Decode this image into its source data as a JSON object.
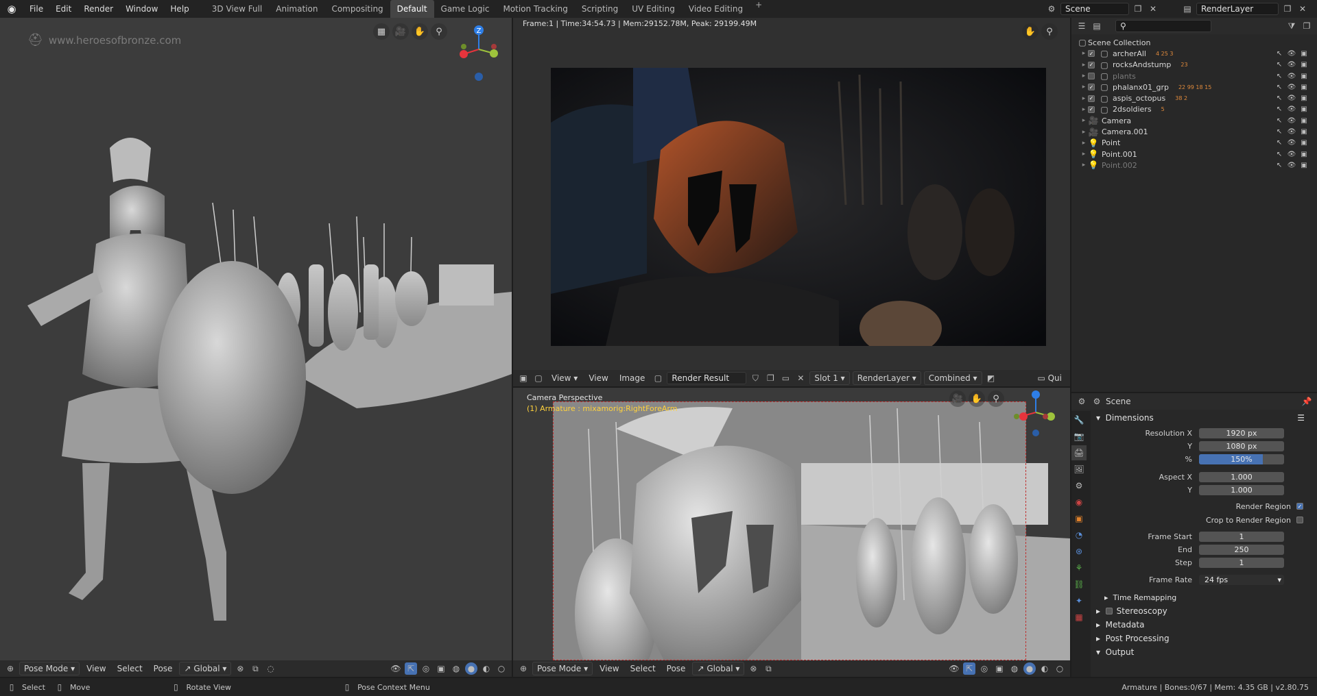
{
  "menus": [
    "File",
    "Edit",
    "Render",
    "Window",
    "Help"
  ],
  "workspaces": [
    "3D View Full",
    "Animation",
    "Compositing",
    "Default",
    "Game Logic",
    "Motion Tracking",
    "Scripting",
    "UV Editing",
    "Video Editing"
  ],
  "active_workspace": "Default",
  "scene": {
    "name": "Scene",
    "render_layer": "RenderLayer"
  },
  "left_viewport": {
    "watermark": "www.heroesofbronze.com",
    "gizmo": {
      "z": "Z",
      "x": "X",
      "y": "Y"
    },
    "header": {
      "editor_icon": "cube-icon",
      "mode": "Pose Mode",
      "view": "View",
      "select": "Select",
      "pose": "Pose",
      "orientation": "Global"
    }
  },
  "render_view": {
    "info": "Frame:1 | Time:34:54.73 | Mem:29152.78M, Peak: 29199.49M",
    "header": {
      "view1": "View",
      "view2": "View",
      "image": "Image",
      "image_name": "Render Result",
      "slot": "Slot 1",
      "layer": "RenderLayer",
      "pass": "Combined",
      "quick": "Qui"
    }
  },
  "camera_viewport": {
    "label": "Camera Perspective",
    "armature": "(1) Armature : mixamorig:RightForeArm",
    "header": {
      "mode": "Pose Mode",
      "view": "View",
      "select": "Select",
      "pose": "Pose",
      "orientation": "Global"
    }
  },
  "outliner": {
    "root": "Scene Collection",
    "items": [
      {
        "name": "archerAll",
        "checked": true,
        "type": "collection",
        "badges": "4 25 3"
      },
      {
        "name": "rocksAndstump",
        "checked": true,
        "type": "collection",
        "badges": "23"
      },
      {
        "name": "plants",
        "checked": false,
        "type": "collection",
        "badges": ""
      },
      {
        "name": "phalanx01_grp",
        "checked": true,
        "type": "collection",
        "badges": "22 99 18 15"
      },
      {
        "name": "aspis_octopus",
        "checked": true,
        "type": "collection",
        "badges": "38 2"
      },
      {
        "name": "2dsoldiers",
        "checked": true,
        "type": "collection",
        "badges": "5"
      },
      {
        "name": "Camera",
        "checked": null,
        "type": "camera",
        "badges": ""
      },
      {
        "name": "Camera.001",
        "checked": null,
        "type": "camera",
        "badges": ""
      },
      {
        "name": "Point",
        "checked": null,
        "type": "light",
        "badges": ""
      },
      {
        "name": "Point.001",
        "checked": null,
        "type": "light",
        "badges": ""
      },
      {
        "name": "Point.002",
        "checked": null,
        "type": "light",
        "badges": ""
      }
    ]
  },
  "properties": {
    "context": "Scene",
    "dimensions": "Dimensions",
    "resolution_x_label": "Resolution X",
    "resolution_x": "1920 px",
    "resolution_y_label": "Y",
    "resolution_y": "1080 px",
    "percent_label": "%",
    "percent": "150%",
    "percent_fill": 0.75,
    "aspect_x_label": "Aspect X",
    "aspect_x": "1.000",
    "aspect_y_label": "Y",
    "aspect_y": "1.000",
    "render_region": "Render Region",
    "render_region_on": true,
    "crop_region": "Crop to Render Region",
    "crop_region_on": false,
    "frame_start_label": "Frame Start",
    "frame_start": "1",
    "end_label": "End",
    "end": "250",
    "step_label": "Step",
    "step": "1",
    "frame_rate_label": "Frame Rate",
    "frame_rate": "24 fps",
    "time_remapping": "Time Remapping",
    "stereoscopy": "Stereoscopy",
    "metadata": "Metadata",
    "post_processing": "Post Processing",
    "output": "Output"
  },
  "statusbar": {
    "select": "Select",
    "move": "Move",
    "rotate": "Rotate View",
    "context": "Pose Context Menu",
    "stats": "Armature | Bones:0/67 | Mem: 4.35 GB | v2.80.75"
  },
  "colors": {
    "accent": "#4772b3",
    "orange": "#e08a3c",
    "header": "#2b2b2b",
    "viewport": "#3c3c3c"
  }
}
